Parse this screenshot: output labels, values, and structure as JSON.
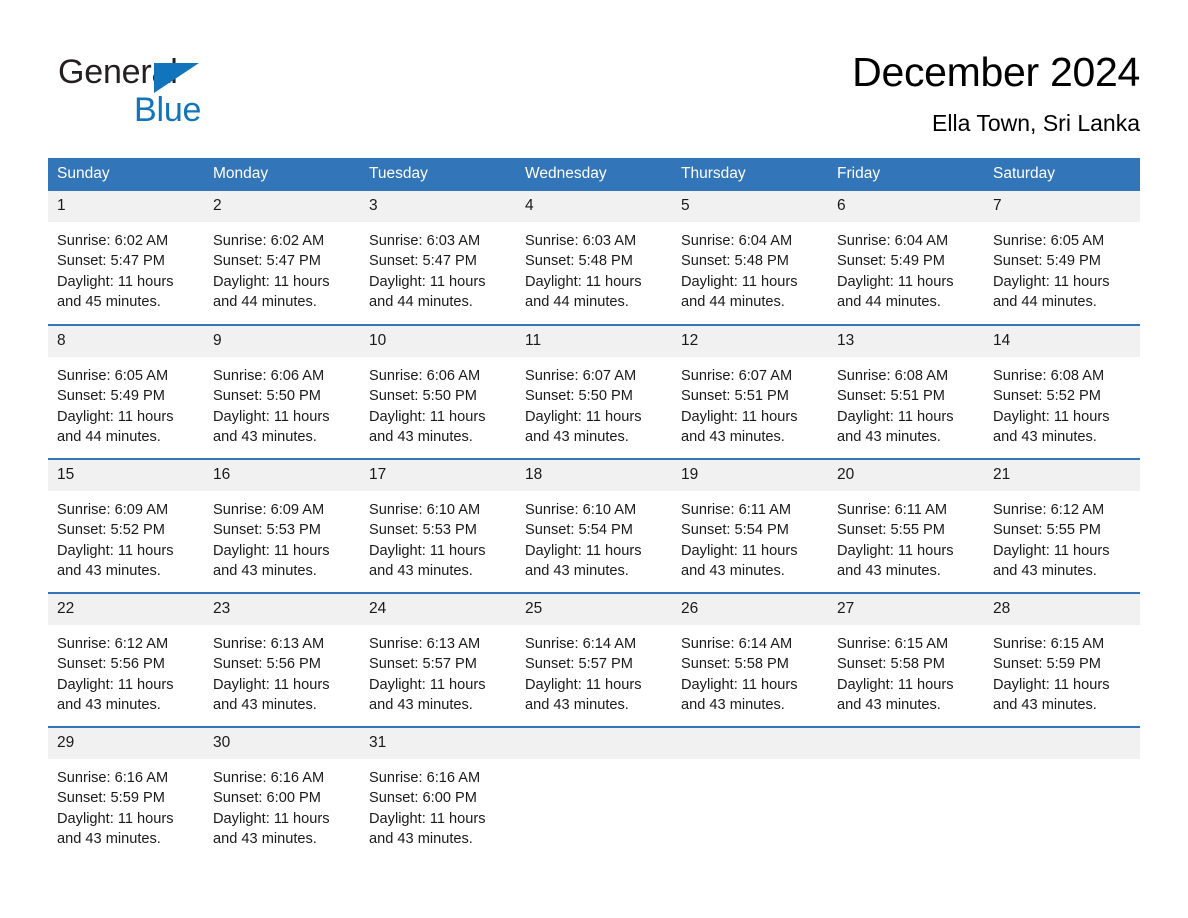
{
  "brand": {
    "name_part1": "General",
    "name_part2": "Blue",
    "triangle_icon": "brand-triangle-icon",
    "accent_color": "#1275bc"
  },
  "header": {
    "title": "December 2024",
    "subtitle": "Ella Town, Sri Lanka"
  },
  "colors": {
    "header_blue": "#3275b8",
    "daynum_band": "#f1f1f1",
    "text": "#1a1a1a"
  },
  "calendar": {
    "weekday_headers": [
      "Sunday",
      "Monday",
      "Tuesday",
      "Wednesday",
      "Thursday",
      "Friday",
      "Saturday"
    ],
    "weeks": [
      [
        {
          "day": "1",
          "sunrise": "Sunrise: 6:02 AM",
          "sunset": "Sunset: 5:47 PM",
          "daylight_line1": "Daylight: 11 hours",
          "daylight_line2": "and 45 minutes."
        },
        {
          "day": "2",
          "sunrise": "Sunrise: 6:02 AM",
          "sunset": "Sunset: 5:47 PM",
          "daylight_line1": "Daylight: 11 hours",
          "daylight_line2": "and 44 minutes."
        },
        {
          "day": "3",
          "sunrise": "Sunrise: 6:03 AM",
          "sunset": "Sunset: 5:47 PM",
          "daylight_line1": "Daylight: 11 hours",
          "daylight_line2": "and 44 minutes."
        },
        {
          "day": "4",
          "sunrise": "Sunrise: 6:03 AM",
          "sunset": "Sunset: 5:48 PM",
          "daylight_line1": "Daylight: 11 hours",
          "daylight_line2": "and 44 minutes."
        },
        {
          "day": "5",
          "sunrise": "Sunrise: 6:04 AM",
          "sunset": "Sunset: 5:48 PM",
          "daylight_line1": "Daylight: 11 hours",
          "daylight_line2": "and 44 minutes."
        },
        {
          "day": "6",
          "sunrise": "Sunrise: 6:04 AM",
          "sunset": "Sunset: 5:49 PM",
          "daylight_line1": "Daylight: 11 hours",
          "daylight_line2": "and 44 minutes."
        },
        {
          "day": "7",
          "sunrise": "Sunrise: 6:05 AM",
          "sunset": "Sunset: 5:49 PM",
          "daylight_line1": "Daylight: 11 hours",
          "daylight_line2": "and 44 minutes."
        }
      ],
      [
        {
          "day": "8",
          "sunrise": "Sunrise: 6:05 AM",
          "sunset": "Sunset: 5:49 PM",
          "daylight_line1": "Daylight: 11 hours",
          "daylight_line2": "and 44 minutes."
        },
        {
          "day": "9",
          "sunrise": "Sunrise: 6:06 AM",
          "sunset": "Sunset: 5:50 PM",
          "daylight_line1": "Daylight: 11 hours",
          "daylight_line2": "and 43 minutes."
        },
        {
          "day": "10",
          "sunrise": "Sunrise: 6:06 AM",
          "sunset": "Sunset: 5:50 PM",
          "daylight_line1": "Daylight: 11 hours",
          "daylight_line2": "and 43 minutes."
        },
        {
          "day": "11",
          "sunrise": "Sunrise: 6:07 AM",
          "sunset": "Sunset: 5:50 PM",
          "daylight_line1": "Daylight: 11 hours",
          "daylight_line2": "and 43 minutes."
        },
        {
          "day": "12",
          "sunrise": "Sunrise: 6:07 AM",
          "sunset": "Sunset: 5:51 PM",
          "daylight_line1": "Daylight: 11 hours",
          "daylight_line2": "and 43 minutes."
        },
        {
          "day": "13",
          "sunrise": "Sunrise: 6:08 AM",
          "sunset": "Sunset: 5:51 PM",
          "daylight_line1": "Daylight: 11 hours",
          "daylight_line2": "and 43 minutes."
        },
        {
          "day": "14",
          "sunrise": "Sunrise: 6:08 AM",
          "sunset": "Sunset: 5:52 PM",
          "daylight_line1": "Daylight: 11 hours",
          "daylight_line2": "and 43 minutes."
        }
      ],
      [
        {
          "day": "15",
          "sunrise": "Sunrise: 6:09 AM",
          "sunset": "Sunset: 5:52 PM",
          "daylight_line1": "Daylight: 11 hours",
          "daylight_line2": "and 43 minutes."
        },
        {
          "day": "16",
          "sunrise": "Sunrise: 6:09 AM",
          "sunset": "Sunset: 5:53 PM",
          "daylight_line1": "Daylight: 11 hours",
          "daylight_line2": "and 43 minutes."
        },
        {
          "day": "17",
          "sunrise": "Sunrise: 6:10 AM",
          "sunset": "Sunset: 5:53 PM",
          "daylight_line1": "Daylight: 11 hours",
          "daylight_line2": "and 43 minutes."
        },
        {
          "day": "18",
          "sunrise": "Sunrise: 6:10 AM",
          "sunset": "Sunset: 5:54 PM",
          "daylight_line1": "Daylight: 11 hours",
          "daylight_line2": "and 43 minutes."
        },
        {
          "day": "19",
          "sunrise": "Sunrise: 6:11 AM",
          "sunset": "Sunset: 5:54 PM",
          "daylight_line1": "Daylight: 11 hours",
          "daylight_line2": "and 43 minutes."
        },
        {
          "day": "20",
          "sunrise": "Sunrise: 6:11 AM",
          "sunset": "Sunset: 5:55 PM",
          "daylight_line1": "Daylight: 11 hours",
          "daylight_line2": "and 43 minutes."
        },
        {
          "day": "21",
          "sunrise": "Sunrise: 6:12 AM",
          "sunset": "Sunset: 5:55 PM",
          "daylight_line1": "Daylight: 11 hours",
          "daylight_line2": "and 43 minutes."
        }
      ],
      [
        {
          "day": "22",
          "sunrise": "Sunrise: 6:12 AM",
          "sunset": "Sunset: 5:56 PM",
          "daylight_line1": "Daylight: 11 hours",
          "daylight_line2": "and 43 minutes."
        },
        {
          "day": "23",
          "sunrise": "Sunrise: 6:13 AM",
          "sunset": "Sunset: 5:56 PM",
          "daylight_line1": "Daylight: 11 hours",
          "daylight_line2": "and 43 minutes."
        },
        {
          "day": "24",
          "sunrise": "Sunrise: 6:13 AM",
          "sunset": "Sunset: 5:57 PM",
          "daylight_line1": "Daylight: 11 hours",
          "daylight_line2": "and 43 minutes."
        },
        {
          "day": "25",
          "sunrise": "Sunrise: 6:14 AM",
          "sunset": "Sunset: 5:57 PM",
          "daylight_line1": "Daylight: 11 hours",
          "daylight_line2": "and 43 minutes."
        },
        {
          "day": "26",
          "sunrise": "Sunrise: 6:14 AM",
          "sunset": "Sunset: 5:58 PM",
          "daylight_line1": "Daylight: 11 hours",
          "daylight_line2": "and 43 minutes."
        },
        {
          "day": "27",
          "sunrise": "Sunrise: 6:15 AM",
          "sunset": "Sunset: 5:58 PM",
          "daylight_line1": "Daylight: 11 hours",
          "daylight_line2": "and 43 minutes."
        },
        {
          "day": "28",
          "sunrise": "Sunrise: 6:15 AM",
          "sunset": "Sunset: 5:59 PM",
          "daylight_line1": "Daylight: 11 hours",
          "daylight_line2": "and 43 minutes."
        }
      ],
      [
        {
          "day": "29",
          "sunrise": "Sunrise: 6:16 AM",
          "sunset": "Sunset: 5:59 PM",
          "daylight_line1": "Daylight: 11 hours",
          "daylight_line2": "and 43 minutes."
        },
        {
          "day": "30",
          "sunrise": "Sunrise: 6:16 AM",
          "sunset": "Sunset: 6:00 PM",
          "daylight_line1": "Daylight: 11 hours",
          "daylight_line2": "and 43 minutes."
        },
        {
          "day": "31",
          "sunrise": "Sunrise: 6:16 AM",
          "sunset": "Sunset: 6:00 PM",
          "daylight_line1": "Daylight: 11 hours",
          "daylight_line2": "and 43 minutes."
        },
        {
          "day": "",
          "sunrise": "",
          "sunset": "",
          "daylight_line1": "",
          "daylight_line2": ""
        },
        {
          "day": "",
          "sunrise": "",
          "sunset": "",
          "daylight_line1": "",
          "daylight_line2": ""
        },
        {
          "day": "",
          "sunrise": "",
          "sunset": "",
          "daylight_line1": "",
          "daylight_line2": ""
        },
        {
          "day": "",
          "sunrise": "",
          "sunset": "",
          "daylight_line1": "",
          "daylight_line2": ""
        }
      ]
    ]
  }
}
